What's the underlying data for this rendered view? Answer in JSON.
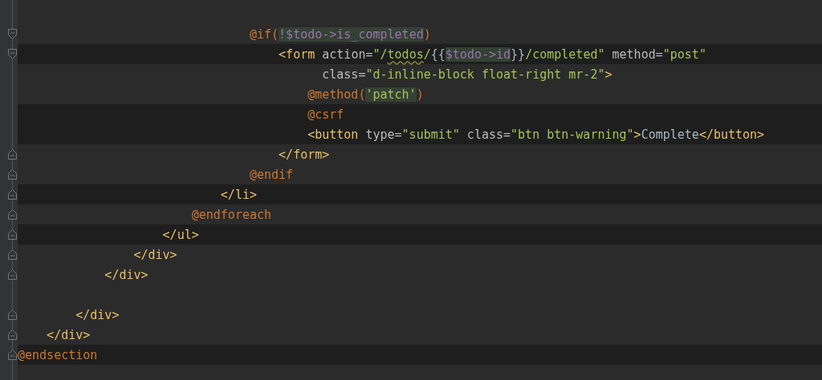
{
  "editor": {
    "items": [
      {
        "items": [
          {
            "items": [
              {
                "items": [
                  {
                    "items": [
                      {
                        "items": [
                          {
                            "items": [
                              {
                                "items": [
                                  {
                                    "items": [
                                      {
                                        "kind": "opener",
                                        "band": false,
                                        "tokens": [
                                          {
                                            "kind": "directive",
                                            "text": "@if("
                                          },
                                          {
                                            "kind": "var",
                                            "text": "!$todo->is_completed",
                                            "highlight": true
                                          },
                                          {
                                            "kind": "directive",
                                            "text": ")"
                                          }
                                        ]
                                      },
                                      {
                                        "items": [
                                          {
                                            "kind": "opener",
                                            "band": true,
                                            "tokens": [
                                              {
                                                "kind": "tag",
                                                "text": "<form"
                                              },
                                              {
                                                "kind": "attr",
                                                "text": " action="
                                              },
                                              {
                                                "kind": "string",
                                                "text": "\"/"
                                              },
                                              {
                                                "kind": "string",
                                                "text": "todos",
                                                "squiggle": true
                                              },
                                              {
                                                "kind": "string",
                                                "text": "/"
                                              },
                                              {
                                                "kind": "plain",
                                                "text": "{{"
                                              },
                                              {
                                                "kind": "var",
                                                "text": "$todo->id",
                                                "highlight": true
                                              },
                                              {
                                                "kind": "plain",
                                                "text": "}}"
                                              },
                                              {
                                                "kind": "string",
                                                "text": "/completed\""
                                              },
                                              {
                                                "kind": "attr",
                                                "text": " method="
                                              },
                                              {
                                                "kind": "string",
                                                "text": "\"post\""
                                              }
                                            ]
                                          },
                                          {
                                            "items": [
                                              {
                                                "kind": "continuation",
                                                "band": false,
                                                "tokens": [
                                                  {
                                                    "kind": "attr",
                                                    "text": "class="
                                                  },
                                                  {
                                                    "kind": "string",
                                                    "text": "\"d-inline-block float-right mr-2\""
                                                  },
                                                  {
                                                    "kind": "tag",
                                                    "text": ">"
                                                  }
                                                ]
                                              },
                                              {
                                                "kind": "code",
                                                "band": false,
                                                "tokens": [
                                                  {
                                                    "kind": "directive",
                                                    "text": "@method("
                                                  },
                                                  {
                                                    "kind": "string",
                                                    "text": "'patch'",
                                                    "highlight": true
                                                  },
                                                  {
                                                    "kind": "directive",
                                                    "text": ")"
                                                  }
                                                ]
                                              },
                                              {
                                                "kind": "code",
                                                "band": true,
                                                "tokens": [
                                                  {
                                                    "kind": "directive",
                                                    "text": "@csrf"
                                                  }
                                                ]
                                              },
                                              {
                                                "kind": "code",
                                                "band": true,
                                                "tokens": [
                                                  {
                                                    "kind": "tag",
                                                    "text": "<button"
                                                  },
                                                  {
                                                    "kind": "attr",
                                                    "text": " type="
                                                  },
                                                  {
                                                    "kind": "string",
                                                    "text": "\"submit\""
                                                  },
                                                  {
                                                    "kind": "attr",
                                                    "text": " class="
                                                  },
                                                  {
                                                    "kind": "string",
                                                    "text": "\"btn btn-warning\""
                                                  },
                                                  {
                                                    "kind": "tag",
                                                    "text": ">"
                                                  },
                                                  {
                                                    "kind": "plain",
                                                    "text": "Complete"
                                                  },
                                                  {
                                                    "kind": "tag",
                                                    "text": "</button>"
                                                  }
                                                ]
                                              }
                                            ]
                                          },
                                          {
                                            "kind": "closer",
                                            "band": false,
                                            "tokens": [
                                              {
                                                "kind": "tag",
                                                "text": "</form>"
                                              }
                                            ]
                                          }
                                        ]
                                      },
                                      {
                                        "kind": "closer",
                                        "band": false,
                                        "tokens": [
                                          {
                                            "kind": "directive",
                                            "text": "@endif"
                                          }
                                        ]
                                      }
                                    ]
                                  },
                                  {
                                    "kind": "closer",
                                    "band": true,
                                    "tokens": [
                                      {
                                        "kind": "tag",
                                        "text": "</li>"
                                      }
                                    ]
                                  }
                                ]
                              },
                              {
                                "kind": "closer",
                                "band": false,
                                "tokens": [
                                  {
                                    "kind": "directive",
                                    "text": "@endforeach"
                                  }
                                ]
                              }
                            ]
                          },
                          {
                            "kind": "closer",
                            "band": true,
                            "tokens": [
                              {
                                "kind": "tag",
                                "text": "</ul>"
                              }
                            ]
                          }
                        ]
                      },
                      {
                        "kind": "closer",
                        "band": false,
                        "tokens": [
                          {
                            "kind": "tag",
                            "text": "</div>"
                          }
                        ]
                      }
                    ]
                  },
                  {
                    "kind": "closer",
                    "band": false,
                    "tokens": [
                      {
                        "kind": "tag",
                        "text": "</div>"
                      }
                    ]
                  }
                ]
              },
              {
                "kind": "blank",
                "band": false
              },
              {
                "kind": "closer",
                "band": false,
                "tokens": [
                  {
                    "kind": "tag",
                    "text": "</div>"
                  }
                ]
              }
            ]
          },
          {
            "kind": "closer",
            "band": false,
            "tokens": [
              {
                "kind": "tag",
                "text": "</div>"
              }
            ]
          }
        ]
      },
      {
        "kind": "closer",
        "band": true,
        "tokens": [
          {
            "kind": "directive",
            "text": "@endsection"
          }
        ]
      }
    ]
  }
}
